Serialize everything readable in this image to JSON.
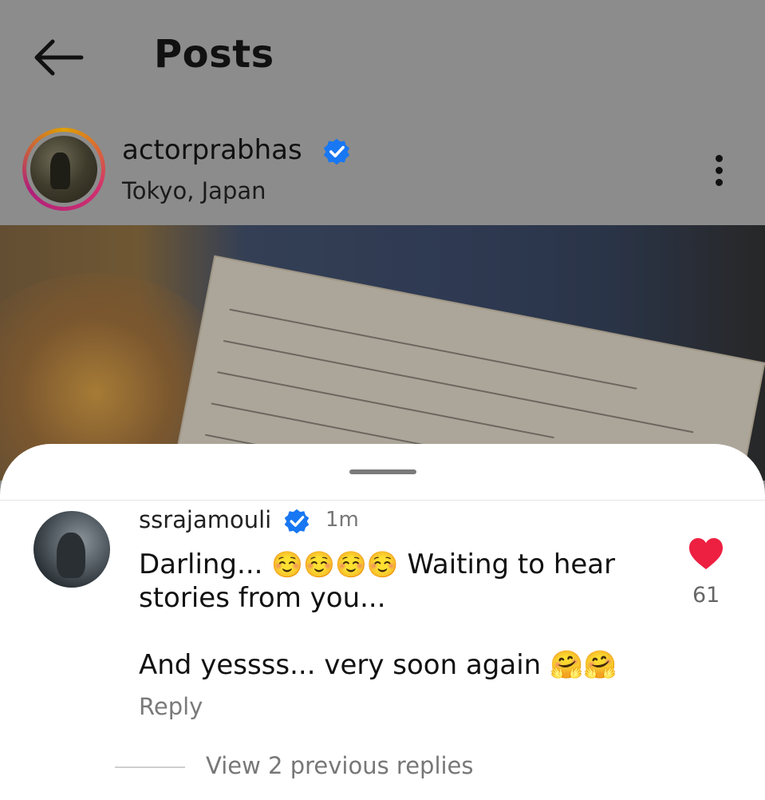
{
  "header": {
    "title": "Posts"
  },
  "post": {
    "username": "actorprabhas",
    "location": "Tokyo, Japan"
  },
  "comment": {
    "username": "ssrajamouli",
    "time": "1m",
    "text_start": "Darling...",
    "emoji_smile": "☺️☺️☺️☺️",
    "text_mid": "Waiting to hear stories from you...",
    "text_second": "And yessss... very soon again",
    "emoji_hug": "🤗🤗",
    "reply_label": "Reply",
    "like_count": "61"
  },
  "replies": {
    "view_label": "View 2 previous replies"
  },
  "colors": {
    "verified": "#1877f2",
    "like_red": "#ed2041",
    "scrim": "#8c8c8c"
  }
}
